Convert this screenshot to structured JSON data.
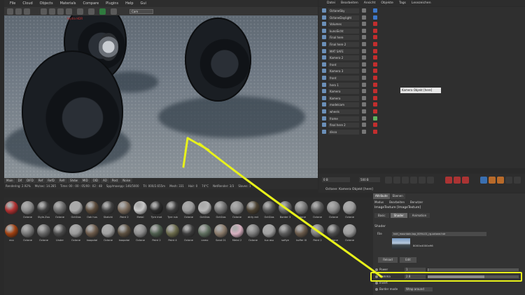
{
  "menubar": [
    "File",
    "Cloud",
    "Objects",
    "Materials",
    "Compare",
    "Plugins",
    "Help",
    "Gui"
  ],
  "camera_select": "Cam",
  "viewport": {
    "overlay_text": "Hydra HDR"
  },
  "render_tabs": [
    "Main",
    "Dif",
    "DIFD",
    "Ref",
    "RefD",
    "Refr",
    "Shdw",
    "MID",
    "OID",
    "AO",
    "Post",
    "Noise"
  ],
  "render_stats": [
    "Rendering: 2.92%",
    "Ms/sec: 14.285",
    "Time: 00 : 00 : 05/00 : 02 : 48",
    "Spp/maxspp: 146/5000",
    "Tri: 000/2.655m",
    "Mesh: 331",
    "Hair: 0",
    "74°C",
    "NetRender: 3/3",
    "Slaves: 1"
  ],
  "materials": {
    "row1": [
      "",
      "",
      "",
      "",
      "",
      "",
      "",
      "",
      "",
      "",
      "",
      "",
      "",
      "",
      "",
      "",
      "",
      "",
      "",
      "",
      "",
      ""
    ],
    "row1_labels": [
      "",
      "Octane",
      "Style.Zou",
      "Octane",
      "OctGlos",
      "Oak hus",
      "Skatchi",
      "Paint 2",
      "Metal",
      "Tyre mat",
      "Tyre rub",
      "Octane",
      "OctGlos",
      "OctGlos",
      "Octane",
      "dirty ext",
      "OctGlos",
      "Border 3",
      "Octane",
      "Octane",
      "Octane",
      "Octane"
    ],
    "row2_labels": [
      "eco",
      "Octane",
      "Octane",
      "Under",
      "Octane",
      "kaopotal",
      "Octane",
      "kaopotal",
      "Octane",
      "Paint 2",
      "Paint 4",
      "Octane",
      "camo",
      "Sand 01",
      "Metal 2",
      "Octane",
      "tuo asu",
      "sofiye",
      "kuffer III",
      "Paint 2",
      "Octane",
      "Octane"
    ]
  },
  "om_header": [
    "Datei",
    "Bearbeiten",
    "Ansicht",
    "Objekte",
    "Tags",
    "Lesezeichen"
  ],
  "objects": [
    "OctaneSky",
    "OctaneDaylight",
    "Volumes",
    "kunoSicht",
    "Final here",
    "Final here 2",
    "MAT SAFE",
    "Kamera 2",
    "front",
    "Kamera 3",
    "front",
    "hero 1",
    "Kamera",
    "Kamera",
    "modelcam",
    "wheels",
    "frame",
    "final here 2",
    "disco"
  ],
  "tooltip": "Kamera Objekt [here]",
  "timeline": {
    "frame": "0 B",
    "end": "500 B"
  },
  "octane_bar": "Octane:   Kamera Objekt [here]",
  "attr": {
    "tabs": [
      "Attribute",
      "Ebenen"
    ],
    "modes": [
      "Modus",
      "Bearbeiten",
      "Benutzer"
    ],
    "title": "ImageTexture [ImageTexture]",
    "subtabs": [
      "Basic",
      "Shader",
      "Animation"
    ],
    "shader_label": "Shader",
    "file_label": "File",
    "file_value": "hdri_mountain-top_0094-01_rg-octane.hdr",
    "dims": "8000x4000x96",
    "reload": "Reload",
    "edit": "Edit",
    "power_label": "Power",
    "power_value": "1",
    "gamma_label": "Gamma",
    "gamma_value": "2.8",
    "invert_label": "Invert",
    "border_label": "Border mode",
    "border_value": "Wrap around"
  },
  "colors": {
    "highlight": "#e8f21a",
    "tag_red": "#c22e2e",
    "tag_green": "#5fb35f",
    "tag_blue": "#3e78c8"
  }
}
